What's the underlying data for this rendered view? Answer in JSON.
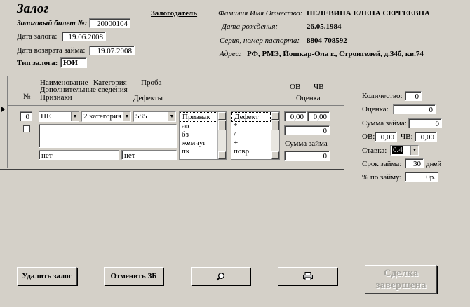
{
  "header": {
    "title": "Залог",
    "ticket_label": "Залоговый билет №:",
    "ticket_value": "20000104",
    "pledge_date_label": "Дата залога:",
    "pledge_date_value": "19.06.2008",
    "return_date_label": "Дата возврата займа:",
    "return_date_value": "19.07.2008",
    "pledge_type_label": "Тип залога:",
    "pledge_type_value": "ЮИ"
  },
  "pledger": {
    "title": "Залогодатель",
    "name_label": "Фамилия Имя Отчество:",
    "name_value": "ПЕЛЕВИНА ЕЛЕНА СЕРГЕЕВНА",
    "birth_label": "Дата рождения:",
    "birth_value": "26.05.1984",
    "passport_label": "Серия, номер паспорта:",
    "passport_value": "8804 708592",
    "address_label": "Адрес:",
    "address_value": "РФ, РМЭ, Йошкар-Ола г., Строителей, д.34б, кв.74"
  },
  "grid": {
    "col_number": "№",
    "col_name": "Наименование",
    "col_category": "Категория",
    "col_probe": "Проба",
    "col_extra": "Дополнительные сведения",
    "col_signs": "Признаки",
    "col_defects": "Дефекты",
    "col_ov": "ОВ",
    "col_chv": "ЧВ",
    "col_estimate": "Оценка",
    "row": {
      "number": "0",
      "name": "НЕ",
      "category": "2 категория",
      "probe": "585",
      "signs_value": "нет",
      "defects_value": "нет",
      "signs_list": [
        "Признак",
        "ао",
        "бз",
        "жемчуг",
        "пк"
      ],
      "defects_list": [
        "Дефект",
        "*",
        "/",
        "+",
        "повр"
      ],
      "ov": "0,00",
      "chv": "0,00",
      "estimate": "0",
      "loan_sum_label": "Сумма займа",
      "loan_sum": "0"
    }
  },
  "summary": {
    "quantity_label": "Количество:",
    "quantity_value": "0",
    "estimate_label": "Оценка:",
    "estimate_value": "0",
    "loan_label": "Сумма займа:",
    "loan_value": "0",
    "ov_label": "ОВ:",
    "ov_value": "0,00",
    "chv_label": "ЧВ:",
    "chv_value": "0,00",
    "rate_label": "Ставка:",
    "rate_value": "0.4",
    "term_label": "Срок займа:",
    "term_value": "30",
    "term_unit": "дней",
    "percent_label": "% по займу:",
    "percent_value": "0р."
  },
  "buttons": {
    "delete": "Удалить залог",
    "cancel": "Отменить ЗБ",
    "search_icon": "magnifier-icon",
    "print_icon": "printer-icon",
    "deal_done_line1": "Сделка",
    "deal_done_line2": "завершена"
  }
}
